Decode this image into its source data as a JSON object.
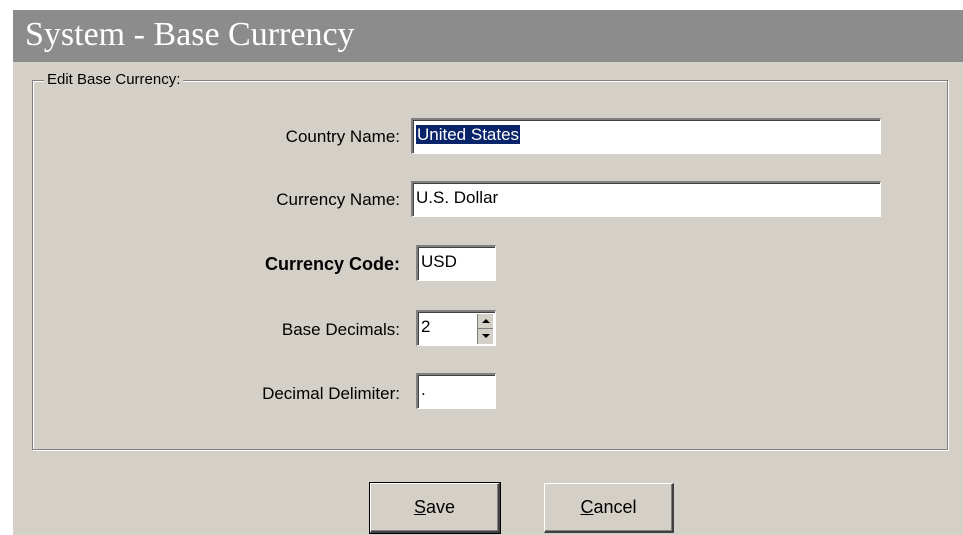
{
  "window": {
    "title": "System - Base Currency"
  },
  "group": {
    "legend": "Edit Base Currency:"
  },
  "fields": {
    "country_name": {
      "label": "Country Name:",
      "value": "United States"
    },
    "currency_name": {
      "label": "Currency Name:",
      "value": "U.S. Dollar"
    },
    "currency_code": {
      "label": "Currency Code:",
      "value": "USD"
    },
    "base_decimals": {
      "label": "Base Decimals:",
      "value": "2"
    },
    "decimal_delimiter": {
      "label": "Decimal Delimiter:",
      "value": "."
    }
  },
  "buttons": {
    "save": {
      "mnemonic": "S",
      "rest": "ave"
    },
    "cancel": {
      "mnemonic": "C",
      "rest": "ancel"
    }
  }
}
